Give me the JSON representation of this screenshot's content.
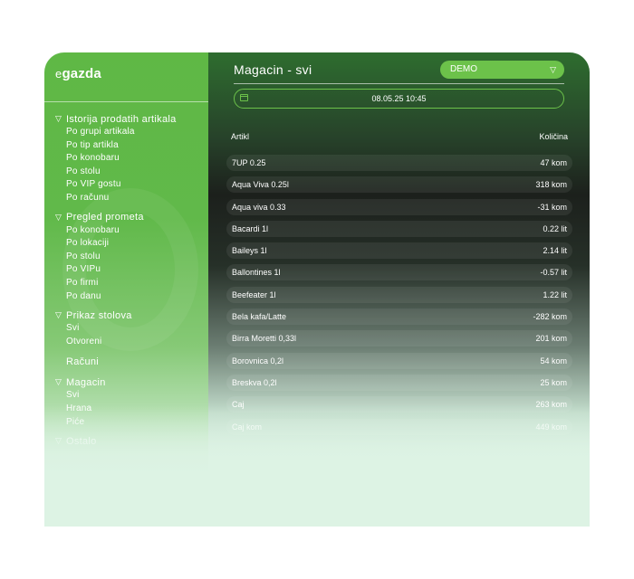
{
  "app": {
    "logo_prefix": "e",
    "logo_name": "gazda"
  },
  "sidebar": {
    "sections": [
      {
        "label": "Istorija prodatih artikala",
        "items": [
          "Po grupi artikala",
          "Po tip artikla",
          "Po konobaru",
          "Po stolu",
          "Po VIP gostu",
          "Po računu"
        ]
      },
      {
        "label": "Pregled prometa",
        "items": [
          "Po konobaru",
          "Po lokaciji",
          "Po stolu",
          "Po VIPu",
          "Po firmi",
          "Po danu"
        ]
      },
      {
        "label": "Prikaz stolova",
        "items": [
          "Svi",
          "Otvoreni"
        ]
      },
      {
        "label": "Magacin",
        "items": [
          "Svi",
          "Hrana",
          "Piće"
        ]
      }
    ],
    "racuni_label": "Računi",
    "ostalo_label": "Ostalo"
  },
  "main": {
    "title": "Magacin - svi",
    "venue_select": "DEMO",
    "date_value": "08.05.25 10:45",
    "col_article": "Artikl",
    "col_quantity": "Količina",
    "rows": [
      {
        "name": "7UP 0.25",
        "qty": "47 kom"
      },
      {
        "name": "Aqua Viva 0.25l",
        "qty": "318 kom"
      },
      {
        "name": "Aqua viva 0.33",
        "qty": "-31 kom"
      },
      {
        "name": "Bacardi 1l",
        "qty": "0.22 lit"
      },
      {
        "name": "Baileys 1l",
        "qty": "2.14 lit"
      },
      {
        "name": "Ballontines 1l",
        "qty": "-0.57 lit"
      },
      {
        "name": "Beefeater 1l",
        "qty": "1.22 lit"
      },
      {
        "name": "Bela kafa/Latte",
        "qty": "-282 kom"
      },
      {
        "name": "Birra Moretti 0,33l",
        "qty": "201 kom"
      },
      {
        "name": "Borovnica 0,2l",
        "qty": "54 kom"
      },
      {
        "name": "Breskva 0,2l",
        "qty": "25 kom"
      },
      {
        "name": "Caj",
        "qty": "263 kom"
      },
      {
        "name": "Caj kom",
        "qty": "449 kom"
      }
    ]
  },
  "colors": {
    "accent": "#6cc24a",
    "sidebar": "#5fb845",
    "panel_dark": "#1c201c",
    "fade": "#ddf3e4"
  }
}
